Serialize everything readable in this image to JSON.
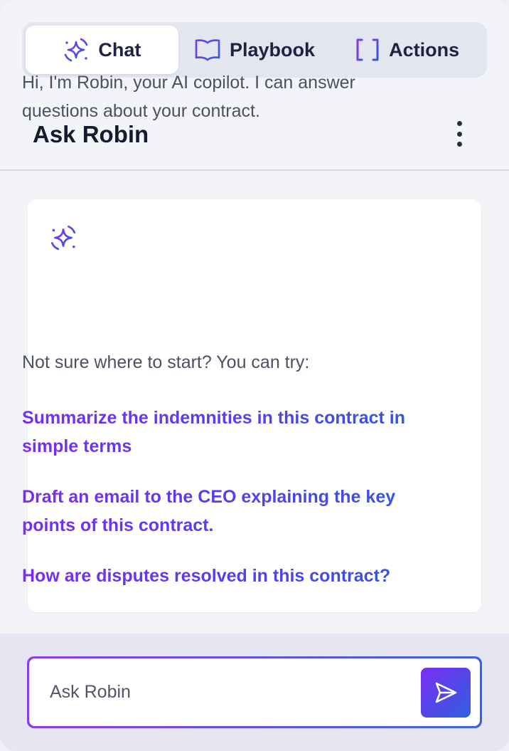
{
  "tabs": [
    {
      "label": "Chat",
      "icon": "sparkle-icon",
      "active": true
    },
    {
      "label": "Playbook",
      "icon": "book-icon",
      "active": false
    },
    {
      "label": "Actions",
      "icon": "brackets-icon",
      "active": false
    }
  ],
  "header": {
    "title": "Ask Robin",
    "menu_icon": "more-vertical-icon"
  },
  "message": {
    "icon": "sparkle-icon",
    "intro": "Hi, I'm Robin, your AI copilot. I can answer questions about your contract.",
    "prompt": "Not sure where to start? You can try:",
    "suggestions": [
      "Summarize the indemnities in this contract in simple terms",
      "Draft an email to the CEO explaining the key points of this contract.",
      "How are disputes resolved in this contract?"
    ]
  },
  "input": {
    "placeholder": "Ask Robin",
    "value": "",
    "send_icon": "send-icon"
  },
  "colors": {
    "accent_purple": "#7b2cf0",
    "accent_blue": "#2f58e0",
    "background": "#f3f4f8",
    "text": "#1b1f33"
  }
}
